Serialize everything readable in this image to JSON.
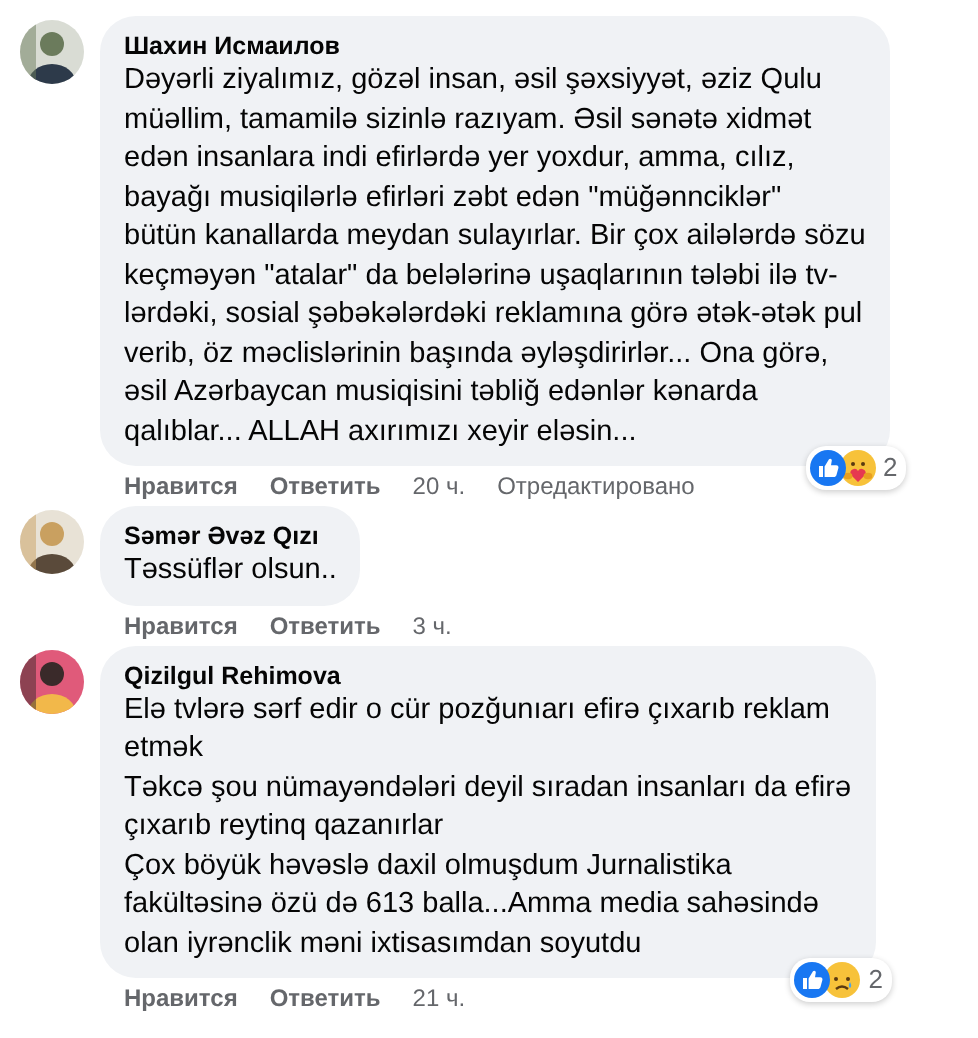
{
  "comments": [
    {
      "author": "Шахин Исмаилов",
      "avatar": {
        "kind": "picture"
      },
      "lines": [
        "Dəyərli ziyalımız, gözəl insan, əsil şəxsiyyət, əziz Qulu",
        "müəllim, tamamilə sizinlə razıyam. Əsil sənətə xidmət",
        "edən insanlara indi efirlərdə yer yoxdur, amma, cılız,",
        "bayağı musiqilərlə efirləri zəbt edən \"müğənnciklər\"",
        "bütün kanallarda meydan sulayırlar. Bir çox ailələrdə sözu",
        "keçməyən \"atalar\" da belələrinə uşaqlarının tələbi ilə tv-",
        "lərdəki, sosial şəbəkələrdəki reklamına görə ətək-ətək pul",
        "verib, öz məclislərinin başında əyləşdirirlər... Ona görə,",
        "əsil Azərbaycan musiqisini təbliğ edənlər kənarda",
        "qalıblar... ALLAH axırımızı xeyir eləsin..."
      ],
      "reactions": {
        "icons": [
          {
            "kind": "like"
          },
          {
            "kind": "care"
          }
        ],
        "count": "2"
      },
      "actions": [
        "Нравится",
        "Ответить"
      ],
      "time": "20 ч.",
      "edited": "Отредактировано"
    },
    {
      "author": "Səmər Əvəz Qızı",
      "avatar": {
        "kind": "picture"
      },
      "lines": [
        "Təssüflər olsun.."
      ],
      "actions": [
        "Нравится",
        "Ответить"
      ],
      "time": "3 ч."
    },
    {
      "author": "Qizilgul Rehimova",
      "avatar": {
        "kind": "picture"
      },
      "lines": [
        "Elə tvlərə sərf edir o cür pozğunıarı efirə çıxarıb reklam",
        "etmək",
        "Təkcə şou nümayəndələri deyil sıradan insanları da efirə",
        "çıxarıb reytinq qazanırlar",
        "Çox böyük həvəslə daxil olmuşdum Jurnalistika",
        "fakültəsinə özü də 613 balla...Amma media sahəsində",
        "olan iyrənclik məni ixtisasımdan soyutdu"
      ],
      "reactions": {
        "icons": [
          {
            "kind": "like"
          },
          {
            "kind": "sad"
          }
        ],
        "count": "2"
      },
      "actions": [
        "Нравится",
        "Ответить"
      ],
      "time": "21 ч."
    }
  ]
}
